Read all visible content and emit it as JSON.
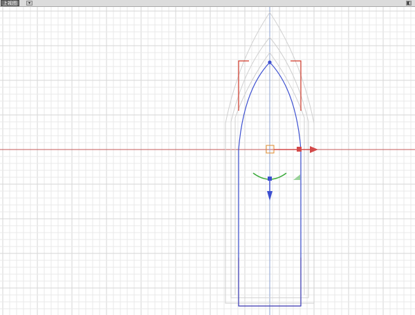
{
  "viewport": {
    "label": "上视图",
    "dropdown_glyph": "▾",
    "options_glyph": "◧"
  },
  "colors": {
    "grid_minor": "#e9e9e9",
    "grid_major": "#d6d6d6",
    "axis_x": "#c45a5a",
    "axis_y": "#8aa0d0",
    "outline_light": "#cfcfcf",
    "outline_red": "#d33a2a",
    "outline_blue": "#3c4fd0",
    "gizmo_red": "#d34a4a",
    "gizmo_blue": "#3c4fd0",
    "gizmo_green": "#3aaa3a",
    "pivot_orange": "#e08a2a"
  },
  "icons": {
    "move_x_arrow": "arrow-right-icon",
    "move_y_arrow": "arrow-down-icon",
    "rotate_arc": "rotate-arc-icon",
    "scale_corner": "scale-triangle-icon",
    "pivot": "pivot-square-icon"
  }
}
